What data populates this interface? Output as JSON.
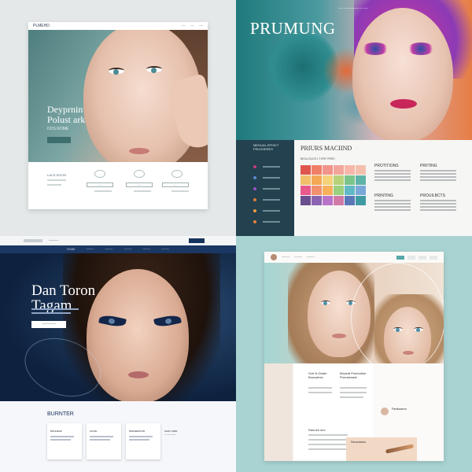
{
  "q1": {
    "brand": "PLMEHD",
    "nav": [
      "---",
      "---",
      "---"
    ],
    "hero_title_line1": "Deyprnin",
    "hero_title_line2": "Polust ark",
    "hero_sub": "DOS ROME",
    "section_label": "LACS SOCRI",
    "pills": [
      "---",
      "---",
      "---"
    ]
  },
  "q2": {
    "title": "PRUMUNG",
    "top_caption": "── ─────── ─ ──",
    "side_heading": "MEOUAL EFHICT",
    "side_sub": "FRUSOERES",
    "main_heading": "PRIURS MACIIND",
    "main_sub": "BEGLIOUCE LT ERF PRES",
    "col1_a": "PROTITIONS",
    "col1_b": "PRINTING",
    "col2_a": "PRIITING",
    "col2_b": "PROUILBCTS",
    "swatches": [
      "#e0564d",
      "#ef7f67",
      "#f1948b",
      "#f4a59a",
      "#f7b7a8",
      "#f3c0ad",
      "#f0c06a",
      "#f3a855",
      "#f4d279",
      "#b8d27a",
      "#7cc48a",
      "#5fb4a7",
      "#e85a8c",
      "#f0906e",
      "#f8b05a",
      "#9bd07e",
      "#61b9c5",
      "#7aa9d9",
      "#6a4f8e",
      "#8a64b0",
      "#b874c9",
      "#d07aa8",
      "#5a78b8",
      "#3f9aa4"
    ],
    "side_dots": [
      "#c83a7d",
      "#5a8ad0",
      "#9a4fc7",
      "#e07a3a",
      "#f29a3c",
      "#e8823d"
    ]
  },
  "q3": {
    "top_mid": "─────",
    "nav": [
      "HOME",
      "────",
      "────",
      "────",
      "────",
      "────"
    ],
    "title_line1": "Dan Toron",
    "title_line2": "Tagam",
    "btn": "───────",
    "section_heading": "BURNTER",
    "cards": [
      "BOHCEAR",
      "ACCIE",
      "RSDAEDIOUR"
    ],
    "right_heading": "SAAT LSRR",
    "right_lines": [
      "─ ── ───"
    ]
  },
  "q4": {
    "nav": [
      "────",
      "────",
      "────"
    ],
    "panel_heading_a": "Sort Ilr Deale\nBowuaheo",
    "panel_heading_b": "Broardt\nPoneruitse\nPrumasnaat",
    "panel_sub": "Ranueh luur",
    "right_heading": "Parakaaeun",
    "product_heading": "Deuwutarsa"
  }
}
